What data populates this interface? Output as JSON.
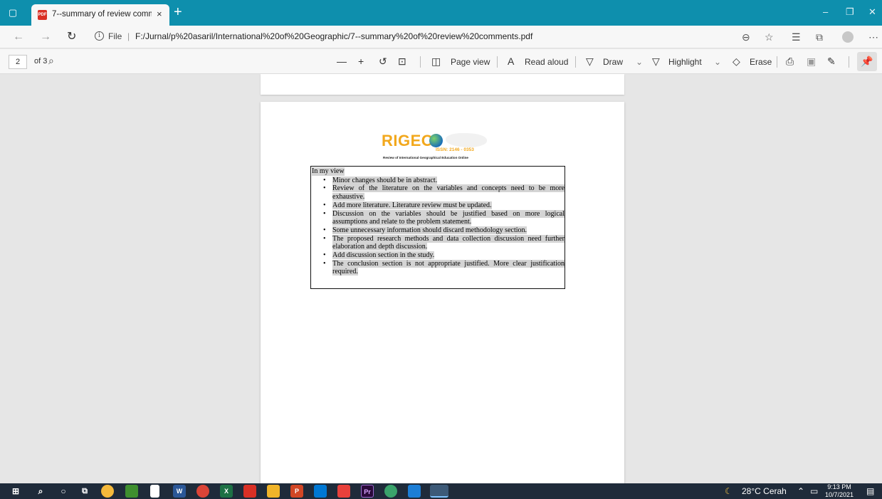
{
  "browser": {
    "tab_title": "7--summary of review comments.pdf",
    "tab_close": "×",
    "new_tab": "+",
    "file_label": "File",
    "url": "F:/Jurnal/p%20asaril/International%20of%20Geographic/7--summary%20of%20review%20comments.pdf",
    "window_controls": {
      "minimize": "–",
      "restore": "❐",
      "close": "✕"
    }
  },
  "pdf_toolbar": {
    "current_page": "2",
    "page_count": "of 3",
    "zoom_out": "—",
    "zoom_in": "+",
    "page_view": "Page view",
    "read_aloud": "Read aloud",
    "draw": "Draw",
    "highlight": "Highlight",
    "erase": "Erase"
  },
  "document": {
    "logo_text": "RIGEO",
    "issn": "ISSN: 2146 - 0353",
    "logo_subtitle": "Review of International Geographical Education Online",
    "intro": "In my view",
    "comments": [
      "Minor changes should be in abstract.",
      "Review of the literature on the variables and concepts need to be more exhaustive.",
      "Add more literature. Literature review must be updated.",
      "Discussion on the variables should be justified based on more logical assumptions and relate to the problem statement.",
      "Some unnecessary information should discard methodology section.",
      "The proposed research methods and data collection discussion need further elaboration and depth discussion.",
      "Add discussion section in the study.",
      "The conclusion section is not appropriate justified. More clear justification required."
    ]
  },
  "taskbar": {
    "weather": "28°C Cerah",
    "time": "9:13 PM",
    "date": "10/7/2021"
  },
  "colors": {
    "tab_strip": "#0e8fad",
    "logo_orange": "#f2a81d",
    "highlight_gray": "#d4d4d4",
    "taskbar": "#1f2b3a"
  }
}
